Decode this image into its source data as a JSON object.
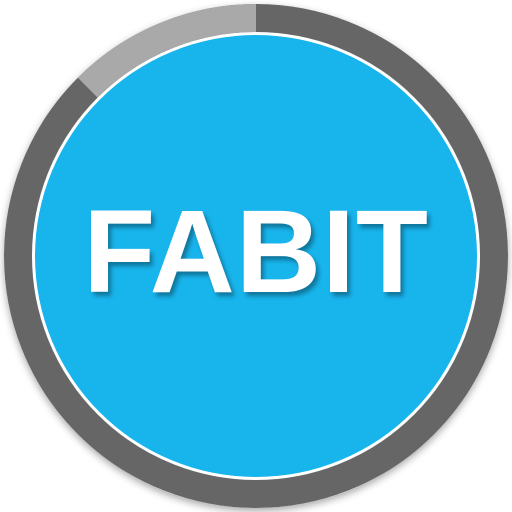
{
  "app_icon": {
    "label": "FABIT",
    "progress_fraction": 0.125,
    "colors": {
      "ring_track": "#666666",
      "ring_progress": "#a9a9a9",
      "face": "#18b4ec",
      "text": "#ffffff"
    }
  }
}
